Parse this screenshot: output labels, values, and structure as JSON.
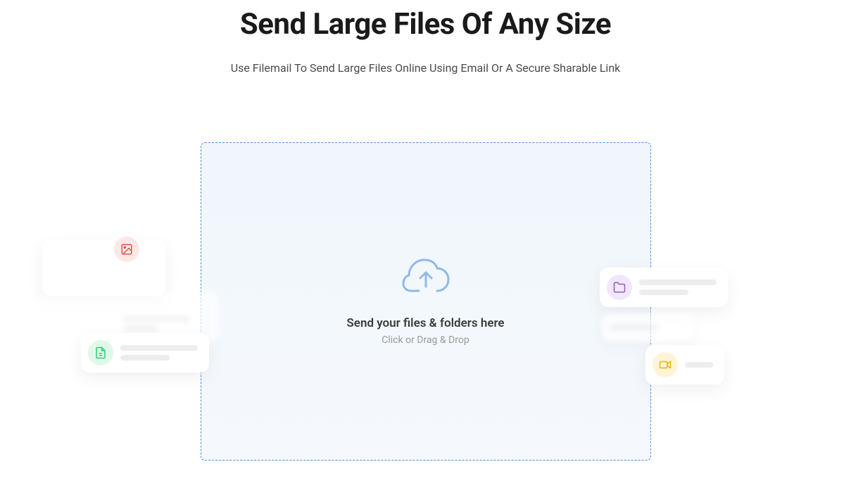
{
  "header": {
    "title": "Send Large Files Of Any Size",
    "subtitle": "Use Filemail To Send Large Files Online Using Email Or A Secure Sharable Link"
  },
  "dropzone": {
    "title": "Send your files & folders here",
    "subtitle": "Click or Drag & Drop"
  },
  "decorativeCards": {
    "image": {
      "iconName": "image-icon",
      "color": "#e55353"
    },
    "document": {
      "iconName": "document-icon",
      "color": "#2ecc71"
    },
    "folder": {
      "iconName": "folder-icon",
      "color": "#9b59b6"
    },
    "video": {
      "iconName": "video-icon",
      "color": "#f1c40f"
    }
  }
}
